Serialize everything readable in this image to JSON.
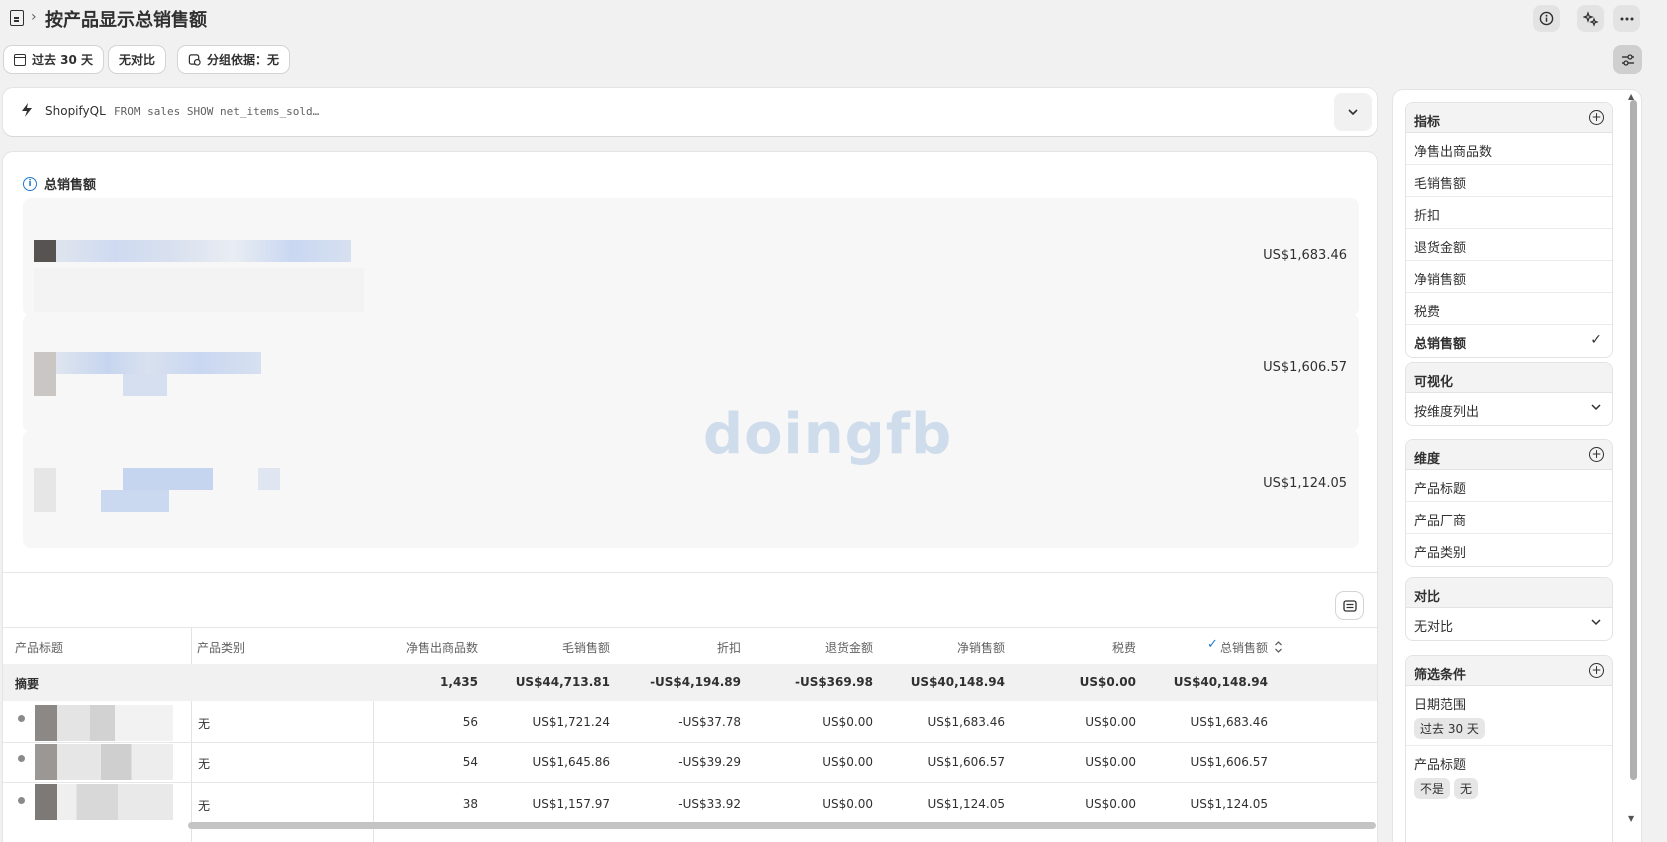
{
  "header": {
    "title": "按产品显示总销售额",
    "breadcrumb_sep": "›",
    "info_icon": "info-icon",
    "sparkle_icon": "sparkle-icon",
    "more_icon": "more-icon"
  },
  "filters": {
    "date_range": "过去 30 天",
    "comparison": "无对比",
    "group_by": "分组依据：无"
  },
  "query": {
    "label": "ShopifyQL",
    "code": "FROM sales SHOW net_items_sold…"
  },
  "chart": {
    "title": "总销售额",
    "rows": [
      {
        "value": "US$1,683.46"
      },
      {
        "value": "US$1,606.57"
      },
      {
        "value": "US$1,124.05"
      }
    ],
    "watermark": "doingfb"
  },
  "table": {
    "headers": [
      "产品标题",
      "产品类别",
      "净售出商品数",
      "毛销售额",
      "折扣",
      "退货金额",
      "净销售额",
      "税费",
      "总销售额"
    ],
    "summary": {
      "label": "摘要",
      "values": [
        "1,435",
        "US$44,713.81",
        "-US$4,194.89",
        "-US$369.98",
        "US$40,148.94",
        "US$0.00",
        "US$40,148.94"
      ]
    },
    "rows": [
      {
        "category": "无",
        "values": [
          "56",
          "US$1,721.24",
          "-US$37.78",
          "US$0.00",
          "US$1,683.46",
          "US$0.00",
          "US$1,683.46"
        ]
      },
      {
        "category": "无",
        "values": [
          "54",
          "US$1,645.86",
          "-US$39.29",
          "US$0.00",
          "US$1,606.57",
          "US$0.00",
          "US$1,606.57"
        ]
      },
      {
        "category": "无",
        "values": [
          "38",
          "US$1,157.97",
          "-US$33.92",
          "US$0.00",
          "US$1,124.05",
          "US$0.00",
          "US$1,124.05"
        ]
      }
    ]
  },
  "sidebar": {
    "metrics": {
      "title": "指标",
      "items": [
        "净售出商品数",
        "毛销售额",
        "折扣",
        "退货金额",
        "净销售额",
        "税费",
        "总销售额"
      ],
      "selected": "总销售额"
    },
    "visualization": {
      "title": "可视化",
      "value": "按维度列出"
    },
    "dimensions": {
      "title": "维度",
      "items": [
        "产品标题",
        "产品厂商",
        "产品类别"
      ]
    },
    "comparison": {
      "title": "对比",
      "value": "无对比"
    },
    "filters": {
      "title": "筛选条件",
      "date_label": "日期范围",
      "date_value": "过去 30 天",
      "product_label": "产品标题",
      "product_tags": [
        "不是",
        "无"
      ]
    }
  },
  "colors": {
    "background": "#f1f1f1",
    "card": "#ffffff",
    "accent_info": "#1f7acf",
    "watermark": "#c8d8ea"
  }
}
